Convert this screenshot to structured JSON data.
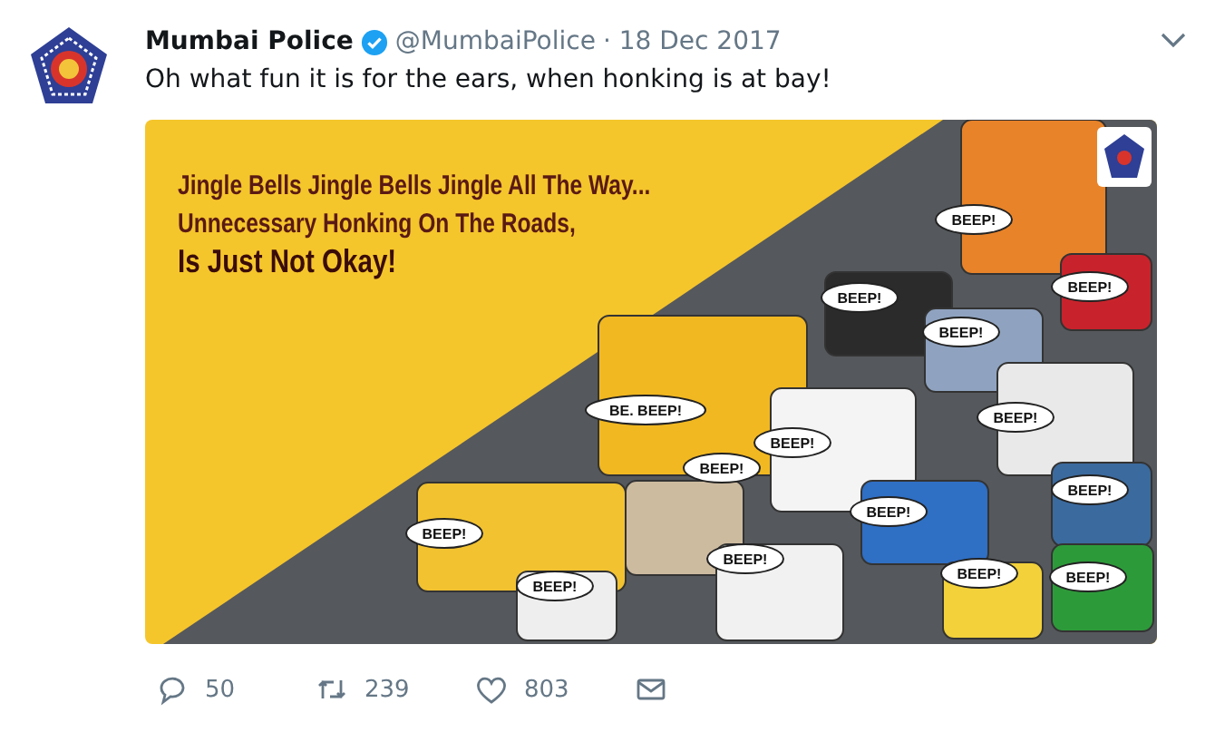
{
  "tweet": {
    "author": "Mumbai Police",
    "handle": "@MumbaiPolice",
    "date": "· 18 Dec 2017",
    "text": "Oh what fun it is for the ears, when honking is at bay!",
    "image": {
      "slogan_lines": [
        "Jingle Bells Jingle Bells Jingle All The Way...",
        "Unnecessary Honking On The Roads,",
        "Is Just Not Okay!"
      ],
      "beep_labels": [
        "BEEP!",
        "BEEP!",
        "BEEP!",
        "BEEP!",
        "BE. BEEP!",
        "BEEP!",
        "BEEP!",
        "BEEP!",
        "BEEP!",
        "BEEP!",
        "BEEP!",
        "BEEP!",
        "BEEP!",
        "BEEP!",
        "BEEP!"
      ]
    },
    "actions": [
      {
        "kind": "reply",
        "count": "50"
      },
      {
        "kind": "retweet",
        "count": "239"
      },
      {
        "kind": "like",
        "count": "803"
      },
      {
        "kind": "message"
      }
    ]
  }
}
